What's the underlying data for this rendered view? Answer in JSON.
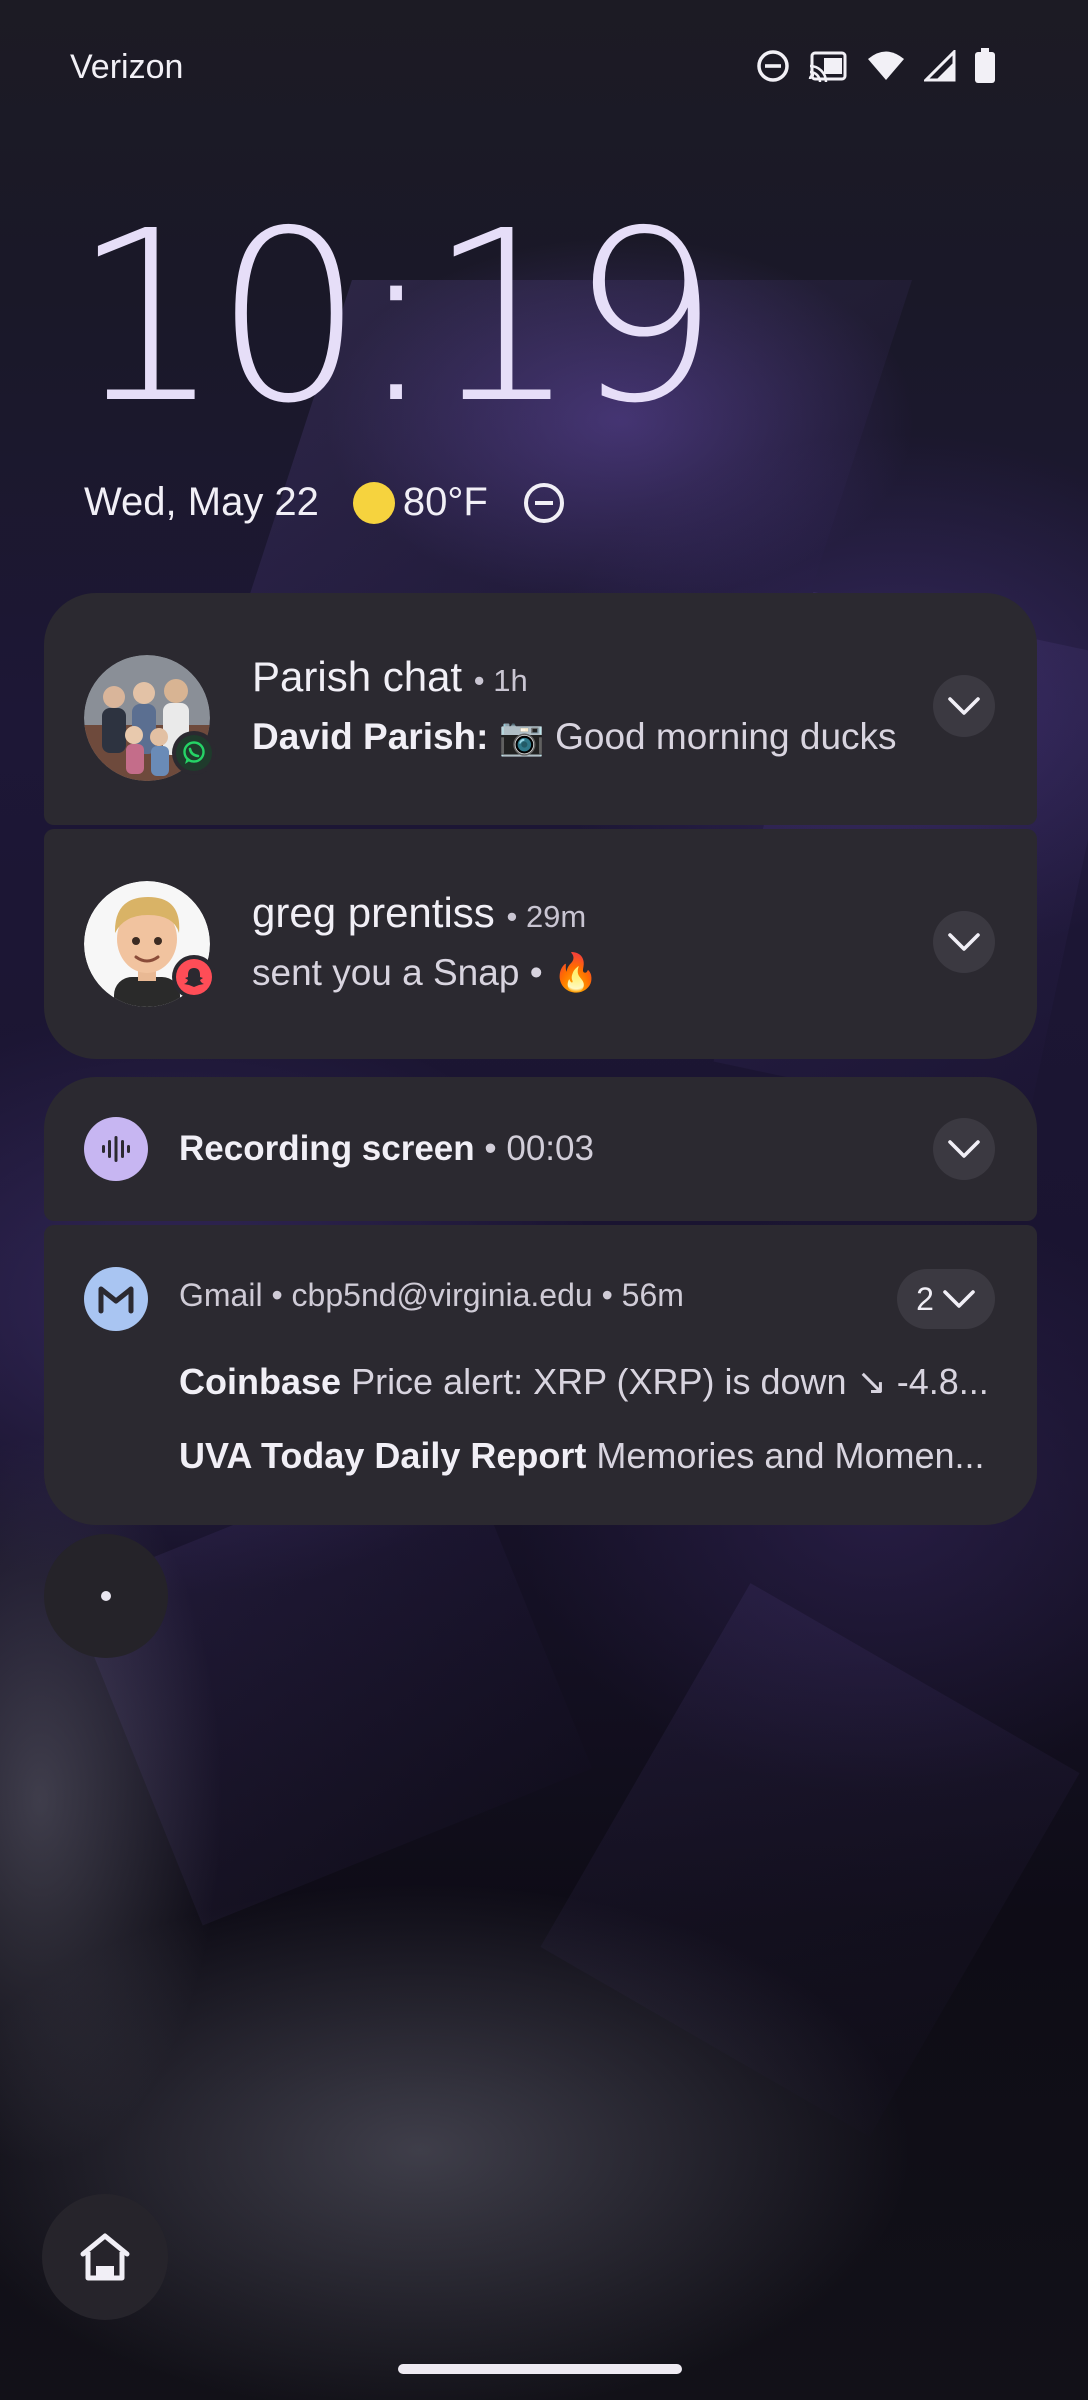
{
  "status_bar": {
    "carrier": "Verizon",
    "icons": [
      "do-not-disturb-icon",
      "cast-icon",
      "wifi-icon",
      "signal-icon",
      "battery-icon"
    ]
  },
  "lockscreen": {
    "time": "10:19",
    "date": "Wed, May 22",
    "weather_icon": "sun-icon",
    "temperature": "80°F",
    "dnd_icon": "do-not-disturb-icon"
  },
  "notifications": [
    {
      "app": "WhatsApp",
      "title": "Parish chat",
      "time": "1h",
      "sender": "David Parish:",
      "message": "📷 Good morning ducks"
    },
    {
      "app": "Snapchat",
      "title": "greg prentiss",
      "time": "29m",
      "message": "sent you a Snap • 🔥"
    },
    {
      "app": "Screen recorder",
      "title": "Recording screen",
      "time": "00:03"
    },
    {
      "app": "Gmail",
      "account": "cbp5nd@virginia.edu",
      "time": "56m",
      "count": "2",
      "emails": [
        {
          "sender": "Coinbase",
          "subject": "Price alert: XRP (XRP) is down ↘ -4.8..."
        },
        {
          "sender": "UVA Today Daily Report",
          "subject": "Memories and Momen..."
        }
      ]
    }
  ],
  "colors": {
    "card": "#2b2930",
    "clock": "#e6def8",
    "sun": "#f6d33e",
    "recorder_icon_bg": "#c7b6f2",
    "gmail_icon_bg": "#a9c5f2",
    "whatsapp_green": "#25d366",
    "snapchat_red": "#ff4d57"
  }
}
